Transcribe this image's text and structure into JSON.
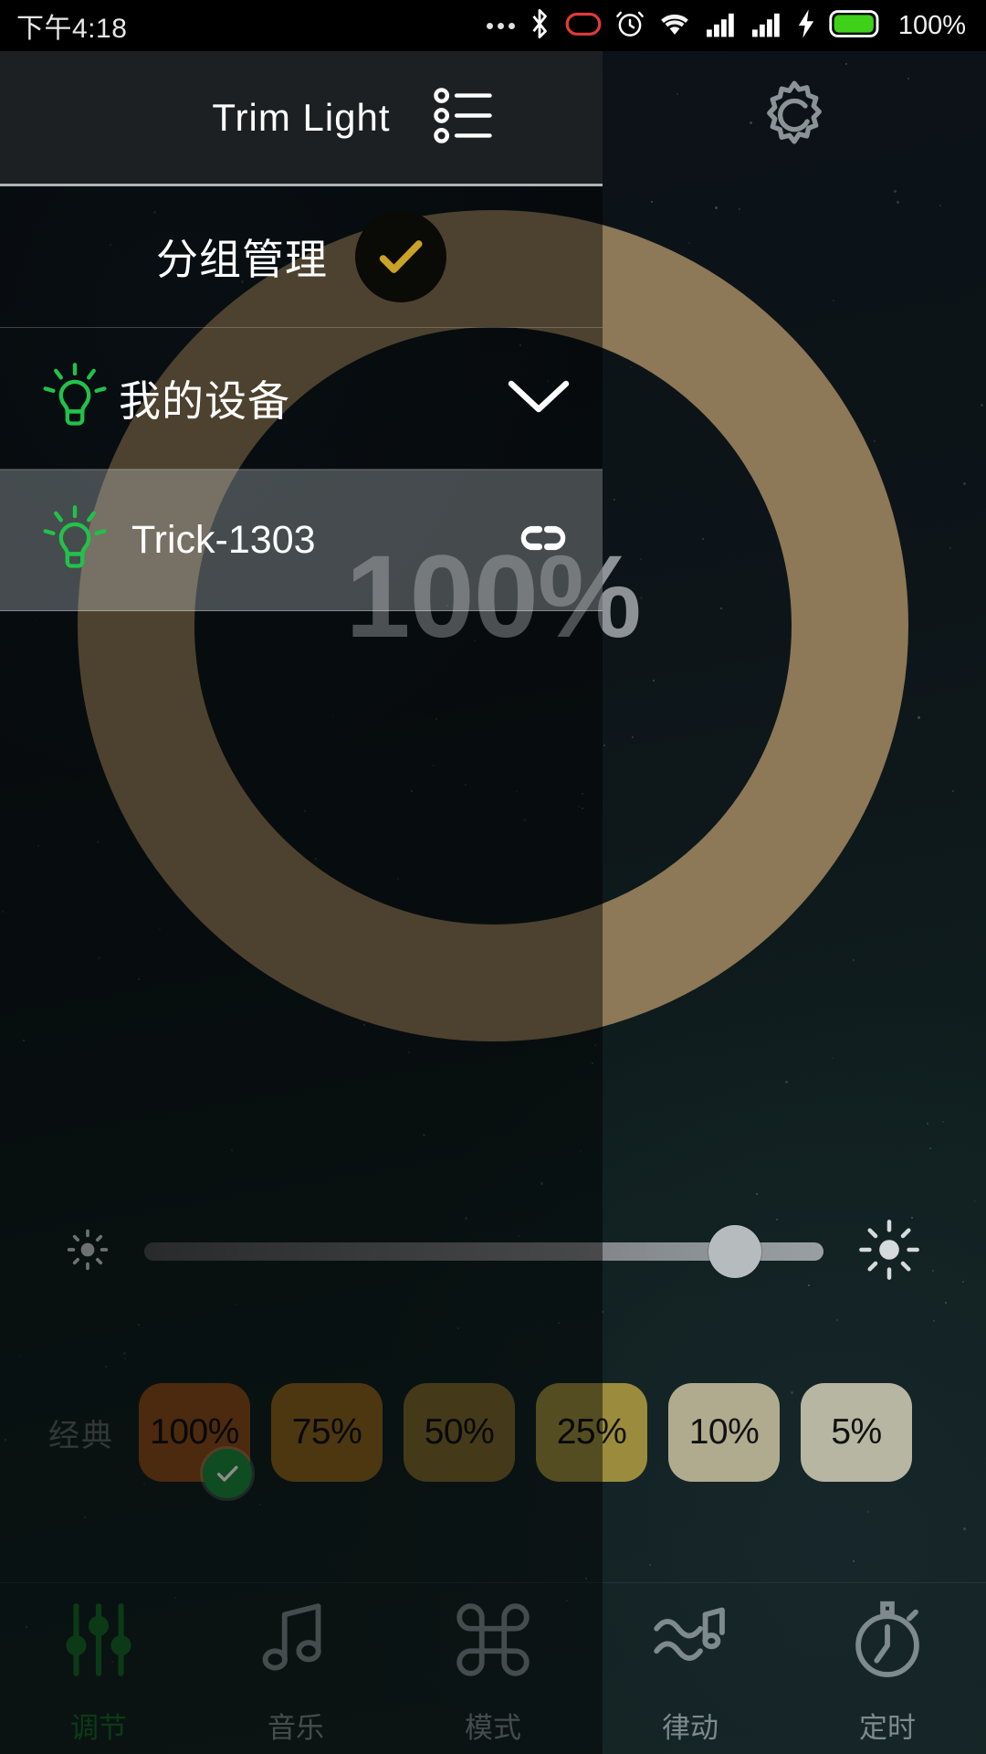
{
  "statusbar": {
    "time": "下午4:18",
    "battery_percent": "100%",
    "icons": [
      "more-dots-icon",
      "bluetooth-icon",
      "do-not-disturb-icon",
      "alarm-icon",
      "wifi-icon",
      "signal-1-icon",
      "signal-2-icon",
      "charging-bolt-icon",
      "battery-icon"
    ]
  },
  "header": {
    "title": "Trim Light",
    "list_icon": "list-bullet-icon",
    "settings_icon": "gear-icon"
  },
  "drawer": {
    "group_manage": {
      "label": "分组管理",
      "check_icon": "check-icon",
      "check_color": "#c9a227"
    },
    "my_devices": {
      "label": "我的设备",
      "bulb_icon": "bulb-icon",
      "chevron_icon": "chevron-down-icon"
    },
    "devices": [
      {
        "name": "Trick-1303",
        "bulb_icon": "bulb-icon",
        "link_icon": "link-icon",
        "selected": true
      }
    ],
    "bulb_color": "#21c24a"
  },
  "dial": {
    "value": "100%",
    "ring_color": "#8d7857",
    "value_color": "#8d9296"
  },
  "slider": {
    "left_icon": "brightness-low-icon",
    "right_icon": "brightness-high-icon",
    "value_percent": 87
  },
  "presets": {
    "label": "经典",
    "items": [
      {
        "label": "100%",
        "color": "#8a4e1c",
        "selected": true
      },
      {
        "label": "75%",
        "color": "#8a6420",
        "selected": false
      },
      {
        "label": "50%",
        "color": "#7d6b2e",
        "selected": false
      },
      {
        "label": "25%",
        "color": "#9a8c3c",
        "selected": false
      },
      {
        "label": "10%",
        "color": "#b0ab8e",
        "selected": false
      },
      {
        "label": "5%",
        "color": "#b7b6a2",
        "selected": false
      }
    ],
    "selected_badge_icon": "check-icon",
    "selected_badge_color": "#1c8a3c"
  },
  "bottomnav": {
    "items": [
      {
        "label": "调节",
        "icon": "sliders-icon",
        "active": true
      },
      {
        "label": "音乐",
        "icon": "music-note-icon",
        "active": false
      },
      {
        "label": "模式",
        "icon": "mode-grid-icon",
        "active": false
      },
      {
        "label": "律动",
        "icon": "rhythm-wave-icon",
        "active": false
      },
      {
        "label": "定时",
        "icon": "timer-icon",
        "active": false
      }
    ],
    "active_color": "#166b2a",
    "inactive_color": "#7e8a8d"
  }
}
